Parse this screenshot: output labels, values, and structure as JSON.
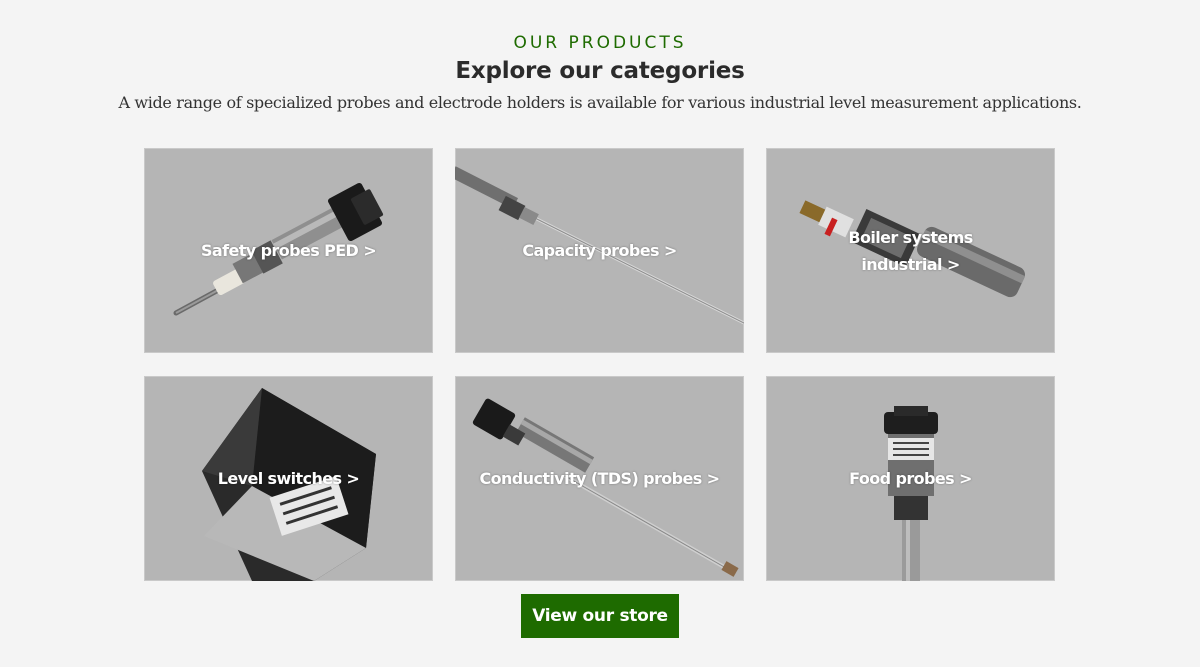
{
  "section": {
    "eyebrow": "OUR PRODUCTS",
    "title": "Explore our categories",
    "subtitle": "A wide range of specialized probes and electrode holders is available for various industrial level measurement applications."
  },
  "categories": [
    {
      "label": "Safety probes PED >",
      "icon": "safety-probe-image"
    },
    {
      "label": "Capacity probes >",
      "icon": "capacity-probe-image"
    },
    {
      "label_line1": "Boiler systems",
      "label_line2": "industrial >",
      "icon": "boiler-probe-image"
    },
    {
      "label": "Level switches >",
      "icon": "level-switch-image"
    },
    {
      "label": "Conductivity (TDS) probes >",
      "icon": "conductivity-probe-image"
    },
    {
      "label": "Food probes >",
      "icon": "food-probe-image"
    }
  ],
  "cta": {
    "label": "View our store"
  },
  "colors": {
    "accent": "#1e6b00",
    "background": "#f4f4f4",
    "card": "#b5b5b5"
  }
}
